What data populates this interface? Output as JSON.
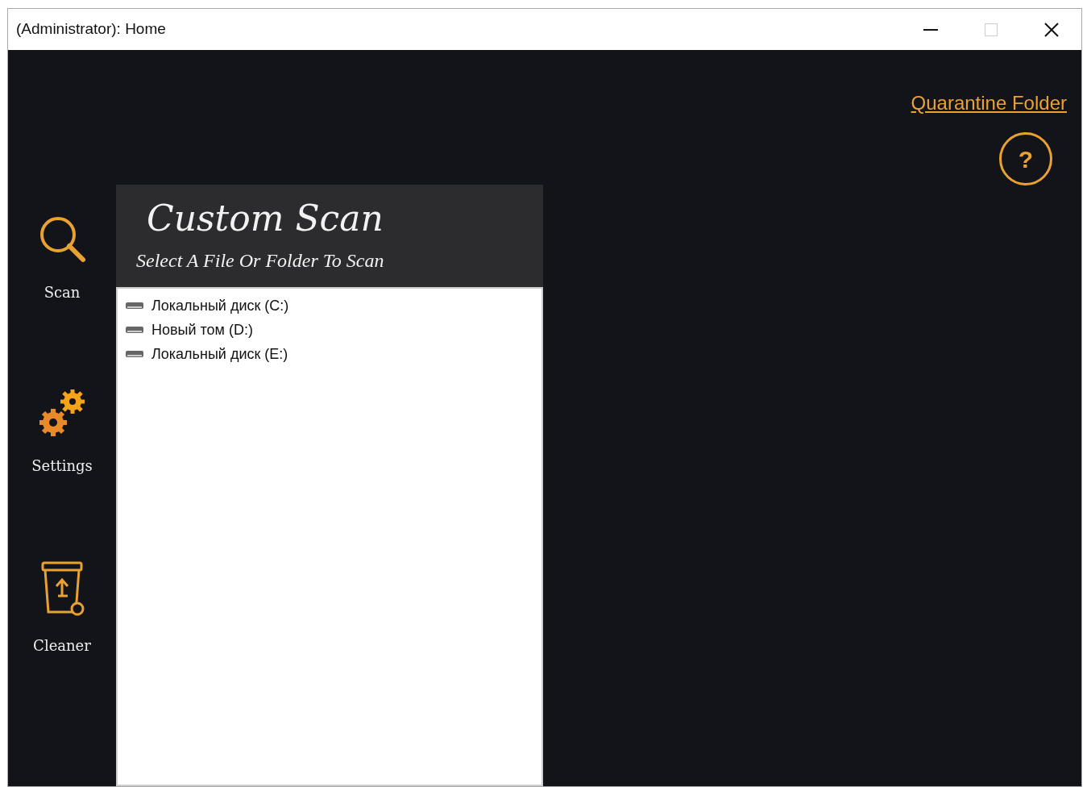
{
  "window": {
    "title": "(Administrator): Home"
  },
  "sidebar": {
    "items": [
      {
        "kind": "scan",
        "label": "Scan"
      },
      {
        "kind": "settings",
        "label": "Settings"
      },
      {
        "kind": "cleaner",
        "label": "Cleaner"
      }
    ]
  },
  "quarantine_link": "Quarantine Folder",
  "help_button": "?",
  "panel": {
    "title": "Custom Scan",
    "subtitle": "Select A File Or Folder To Scan",
    "drives": [
      {
        "label": "Локальный диск (C:)"
      },
      {
        "label": "Новый том (D:)"
      },
      {
        "label": "Локальный диск (E:)"
      }
    ]
  }
}
